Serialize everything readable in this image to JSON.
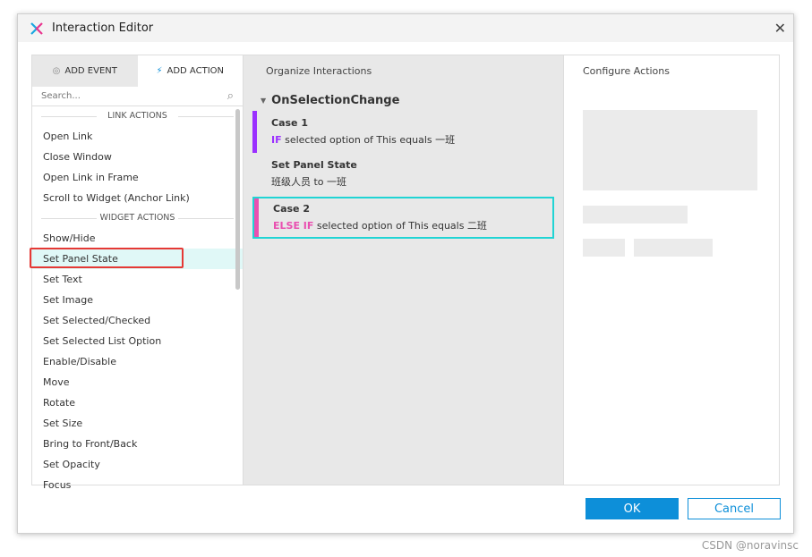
{
  "window": {
    "title": "Interaction Editor"
  },
  "left": {
    "tabs": [
      {
        "label": "ADD EVENT"
      },
      {
        "label": "ADD ACTION"
      }
    ],
    "search_placeholder": "Search...",
    "sections": [
      {
        "title": "LINK ACTIONS",
        "items": [
          "Open Link",
          "Close Window",
          "Open Link in Frame",
          "Scroll to Widget (Anchor Link)"
        ]
      },
      {
        "title": "WIDGET ACTIONS",
        "items": [
          "Show/Hide",
          "Set Panel State",
          "Set Text",
          "Set Image",
          "Set Selected/Checked",
          "Set Selected List Option",
          "Enable/Disable",
          "Move",
          "Rotate",
          "Set Size",
          "Bring to Front/Back",
          "Set Opacity",
          "Focus"
        ]
      }
    ],
    "selected": "Set Panel State"
  },
  "middle": {
    "title": "Organize Interactions",
    "event": "OnSelectionChange",
    "case1": {
      "name": "Case 1",
      "kw": "IF",
      "cond": "selected option of This equals 一班",
      "color": "#9b30ff"
    },
    "action": {
      "name": "Set Panel State",
      "detail": "班级人员 to 一班"
    },
    "case2": {
      "name": "Case 2",
      "kw": "ELSE IF",
      "cond": "selected option of This equals 二班",
      "color": "#e94fb0"
    }
  },
  "right": {
    "title": "Configure Actions"
  },
  "buttons": {
    "ok": "OK",
    "cancel": "Cancel"
  },
  "watermark": "CSDN @noravinsc",
  "colors": {
    "accent": "#0d8fd9",
    "selection_border": "#20d4d4",
    "highlight": "#e53935"
  }
}
